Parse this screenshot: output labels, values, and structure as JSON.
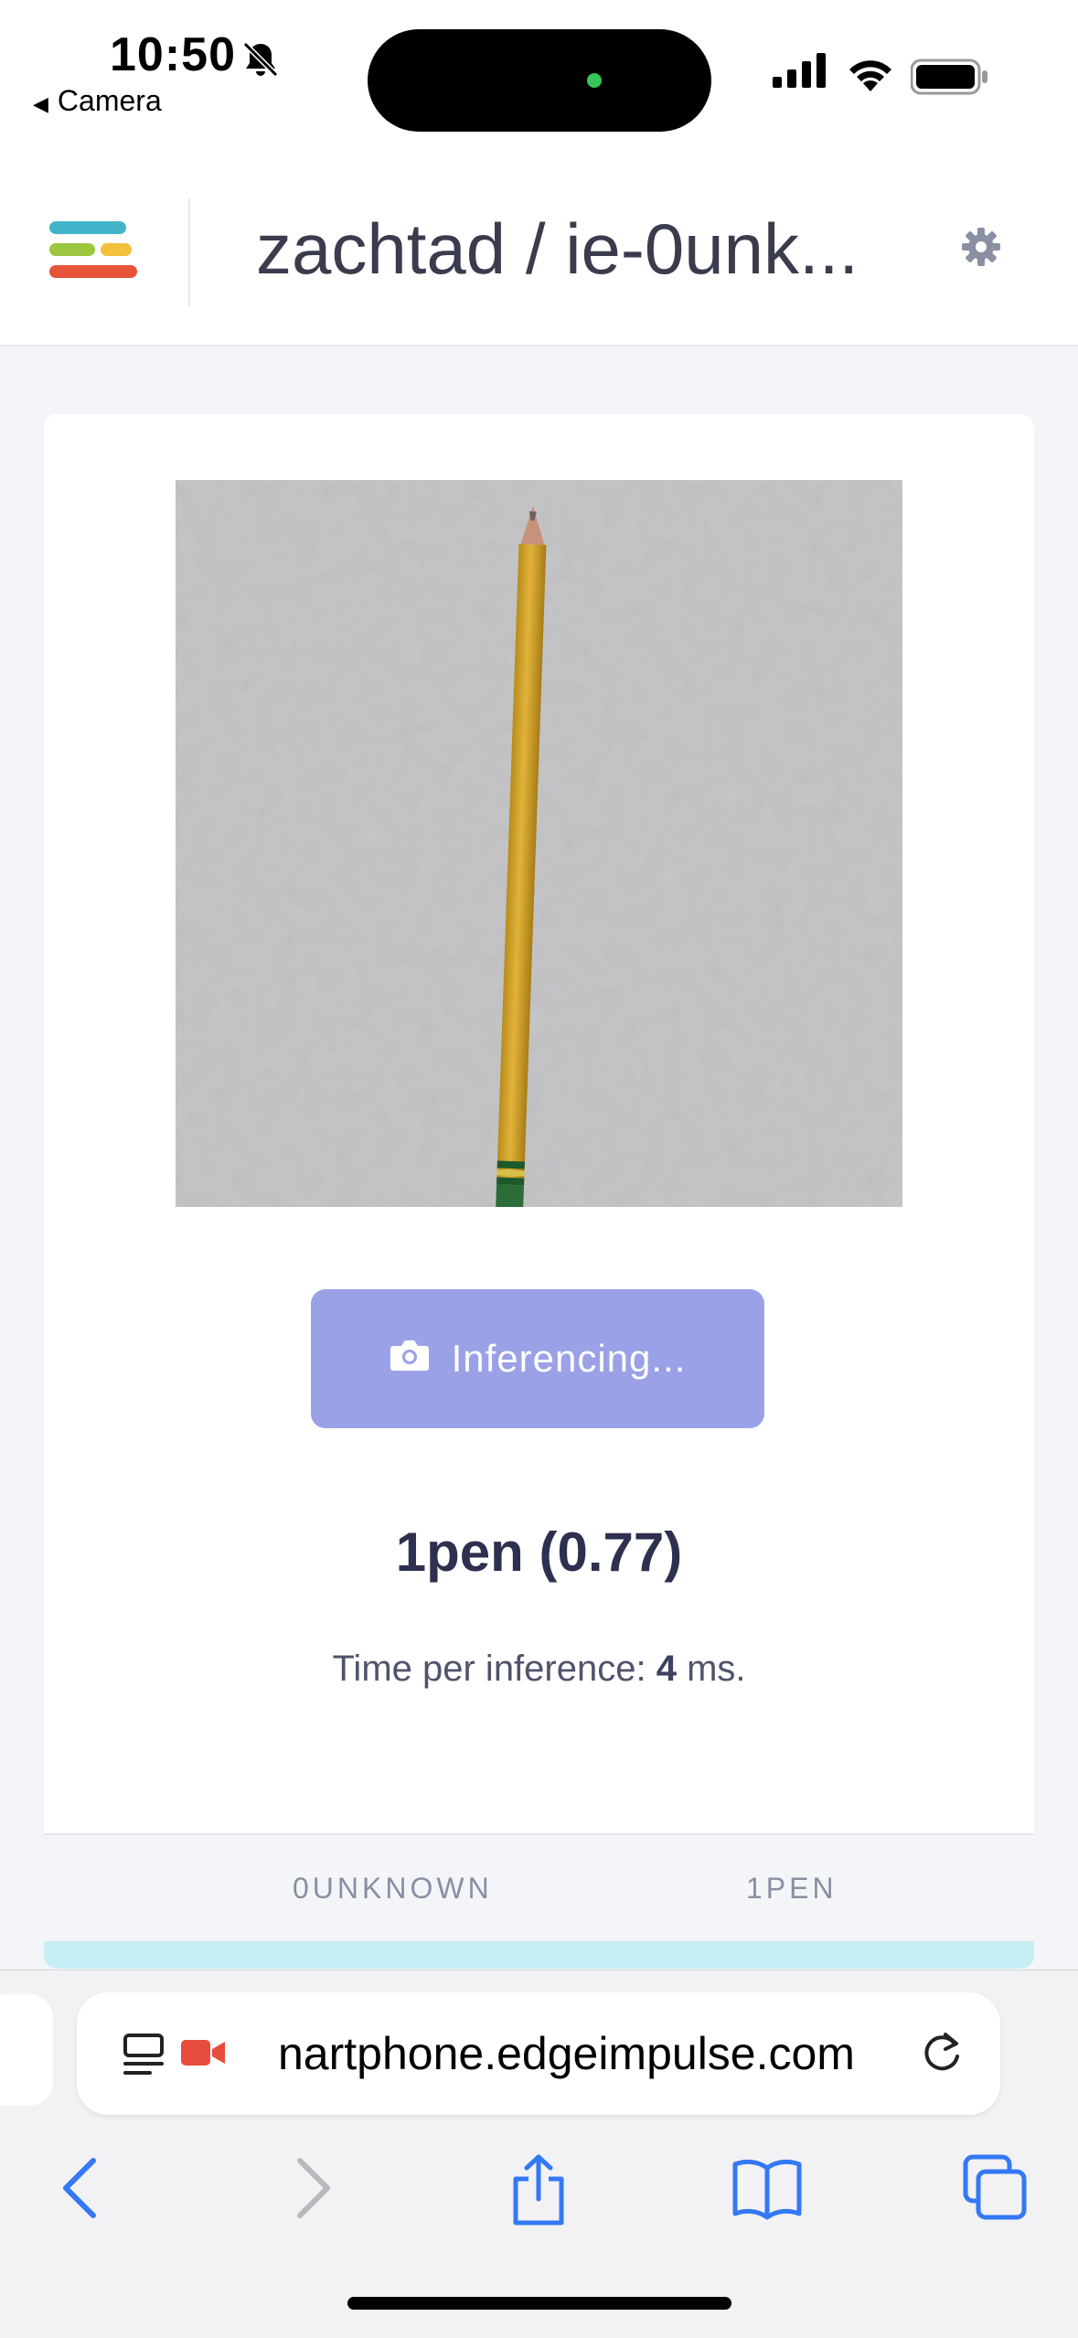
{
  "status_bar": {
    "time": "10:50",
    "back_app": "Camera",
    "icons": [
      "bell-slash-icon",
      "cellular-signal-icon",
      "wifi-icon",
      "battery-icon"
    ]
  },
  "header": {
    "project_title": "zachtad / ie-0unk...",
    "logo": "edge-impulse-logo",
    "settings_icon": "gear-icon"
  },
  "classifier": {
    "button_label": "Inferencing...",
    "button_icon": "camera-icon",
    "result": "1pen (0.77)",
    "timing_prefix": "Time per inference: ",
    "timing_value": "4",
    "timing_suffix": " ms.",
    "classes": [
      "0UNKNOWN",
      "1PEN"
    ]
  },
  "browser": {
    "url": "nartphone.edgeimpulse.com",
    "nav_icons": [
      "back-icon",
      "forward-icon",
      "share-icon",
      "bookmarks-icon",
      "tabs-icon"
    ]
  },
  "colors": {
    "button": "#9aa1e6",
    "accent_blue": "#3478f6",
    "teal_row": "#c6eef5"
  }
}
